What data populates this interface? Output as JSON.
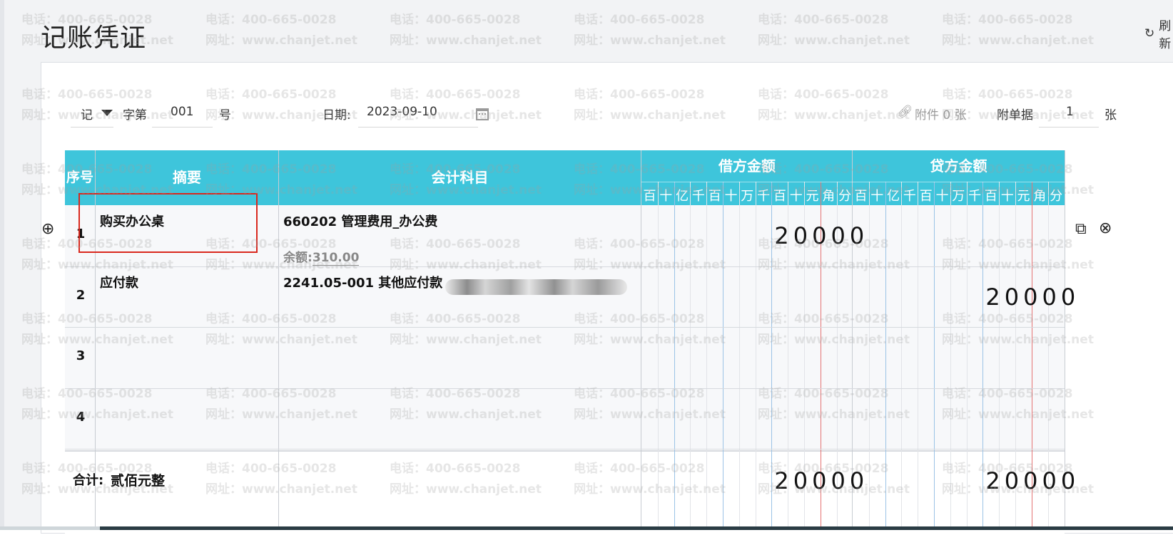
{
  "page": {
    "title": "记账凭证",
    "refresh_label": "刷新"
  },
  "watermark": {
    "phone": "电话：400-665-0028",
    "site": "网址：www.chanjet.net"
  },
  "toolbar": {
    "voucher_type": "记",
    "word_label": "字第",
    "voucher_no": "001",
    "no_suffix": "号",
    "date_label": "日期:",
    "date_value": "2023-09-10",
    "attachment_label": "附件 0 张",
    "doc_label": "附单据",
    "doc_count": "1",
    "doc_unit": "张"
  },
  "table": {
    "headers": {
      "seq": "序号",
      "summary": "摘要",
      "account": "会计科目",
      "debit": "借方金额",
      "credit": "贷方金额"
    },
    "digit_units": [
      "百",
      "十",
      "亿",
      "千",
      "百",
      "十",
      "万",
      "千",
      "百",
      "十",
      "元",
      "角",
      "分"
    ],
    "rows": [
      {
        "seq": "1",
        "summary": "购买办公桌",
        "account": "660202 管理费用_办公费",
        "balance_label": "余额:",
        "balance_value": "310.00",
        "debit": "20000",
        "credit": ""
      },
      {
        "seq": "2",
        "summary": "应付款",
        "account": "2241.05-001 其他应付款",
        "debit": "",
        "credit": "20000"
      },
      {
        "seq": "3",
        "summary": "",
        "account": "",
        "debit": "",
        "credit": ""
      },
      {
        "seq": "4",
        "summary": "",
        "account": "",
        "debit": "",
        "credit": ""
      }
    ],
    "total": {
      "label": "合计:",
      "amount_text": "贰佰元整",
      "debit": "20000",
      "credit": "20000"
    }
  },
  "colors": {
    "header_bg": "#3ec5db",
    "highlight_box": "#d9281e",
    "yuan_line": "#e57373",
    "group_line": "#9bc3e6"
  },
  "icons": [
    "refresh-icon",
    "dropdown-arrow-icon",
    "calendar-icon",
    "link-icon",
    "add-row-icon",
    "copy-row-icon",
    "delete-row-icon"
  ]
}
